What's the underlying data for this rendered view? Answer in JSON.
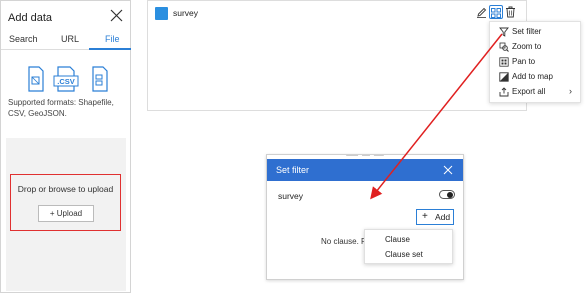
{
  "add_data": {
    "title": "Add data",
    "tabs": [
      {
        "label": "Search"
      },
      {
        "label": "URL"
      },
      {
        "label": "File"
      }
    ],
    "file_types": [
      "shapefile-icon",
      "csv-icon",
      "geojson-icon"
    ],
    "csv_label": ".CSV",
    "supported_formats": "Supported formats: Shapefile, CSV, GeoJSON.",
    "drop_text": "Drop or browse to upload",
    "upload_label": "Upload"
  },
  "layer": {
    "name": "survey",
    "icon": "layer-icon"
  },
  "context_menu": {
    "items": [
      {
        "label": "Set filter",
        "icon": "filter-icon"
      },
      {
        "label": "Zoom to",
        "icon": "zoom-to-icon"
      },
      {
        "label": "Pan to",
        "icon": "pan-to-icon"
      },
      {
        "label": "Add to map",
        "icon": "add-to-map-icon"
      },
      {
        "label": "Export all",
        "icon": "export-icon",
        "has_submenu": true
      }
    ]
  },
  "filter_dialog": {
    "title": "Set filter",
    "layer_name": "survey",
    "add_label": "Add",
    "empty_text": "No clause. Pl"
  },
  "add_menu": {
    "items": [
      {
        "label": "Clause"
      },
      {
        "label": "Clause set"
      }
    ]
  },
  "colors": {
    "accent": "#2b7fd6",
    "dialog_header": "#2f6fd0",
    "highlight": "#e03030",
    "arrow": "#e02020"
  }
}
